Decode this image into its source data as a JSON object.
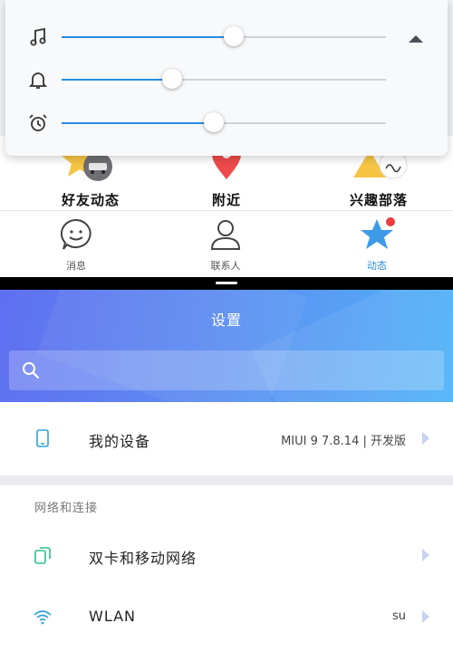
{
  "top_app": {
    "quick_actions": [
      {
        "label": "好友动态"
      },
      {
        "label": "附近"
      },
      {
        "label": "兴趣部落"
      }
    ],
    "bottom_nav": [
      {
        "label": "消息",
        "icon": "chat-bubble-icon"
      },
      {
        "label": "联系人",
        "icon": "contacts-icon"
      },
      {
        "label": "动态",
        "icon": "star-icon",
        "active": true
      }
    ]
  },
  "volume_panel": {
    "sliders": [
      {
        "name": "music",
        "icon": "music-note-icon",
        "level": 0.53
      },
      {
        "name": "ringtone",
        "icon": "bell-icon",
        "level": 0.34
      },
      {
        "name": "alarm",
        "icon": "alarm-clock-icon",
        "level": 0.47
      }
    ],
    "accent_color": "#2a8be0"
  },
  "settings": {
    "title": "设置",
    "search": {
      "placeholder": "",
      "value": ""
    },
    "my_device": {
      "label": "我的设备",
      "value": "MIUI 9 7.8.14 | 开发版"
    },
    "section_network": "网络和连接",
    "dual_sim": {
      "label": "双卡和移动网络"
    },
    "wlan": {
      "label": "WLAN",
      "value": "su"
    }
  }
}
